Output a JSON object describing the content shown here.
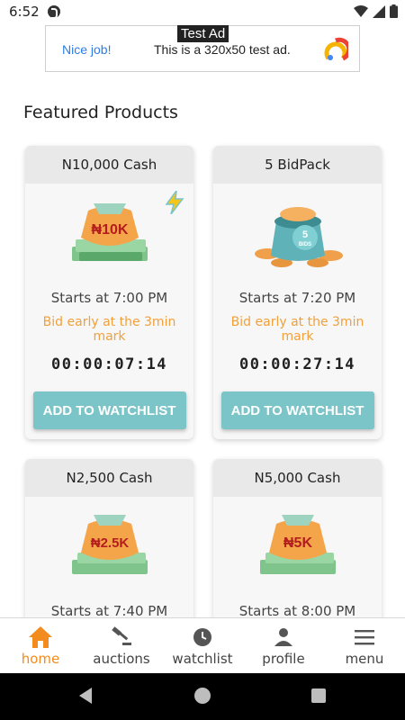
{
  "status_bar": {
    "time": "6:52"
  },
  "ad": {
    "label": "Test Ad",
    "headline": "Nice job!",
    "text": "This is a 320x50 test ad."
  },
  "section_title": "Featured Products",
  "products": [
    {
      "title": "N10,000 Cash",
      "image_label": "₦10K",
      "start": "Starts at 7:00 PM",
      "hint": "Bid early at the 3min mark",
      "timer": "00:00:07:14",
      "button": "ADD TO WATCHLIST"
    },
    {
      "title": "5 BidPack",
      "image_label": "5",
      "image_sublabel": "BIDS",
      "start": "Starts at 7:20 PM",
      "hint": "Bid early at the 3min mark",
      "timer": "00:00:27:14",
      "button": "ADD TO WATCHLIST"
    },
    {
      "title": "N2,500 Cash",
      "image_label": "₦2.5K",
      "start": "Starts at 7:40 PM"
    },
    {
      "title": "N5,000 Cash",
      "image_label": "₦5K",
      "start": "Starts at 8:00 PM"
    }
  ],
  "nav": [
    {
      "label": "home",
      "icon": "home-icon",
      "active": true
    },
    {
      "label": "auctions",
      "icon": "gavel-icon",
      "active": false
    },
    {
      "label": "watchlist",
      "icon": "clock-icon",
      "active": false
    },
    {
      "label": "profile",
      "icon": "person-icon",
      "active": false
    },
    {
      "label": "menu",
      "icon": "menu-icon",
      "active": false
    }
  ],
  "colors": {
    "accent": "#f28c1e",
    "button": "#7bc4c8",
    "hint": "#f2a03a"
  }
}
